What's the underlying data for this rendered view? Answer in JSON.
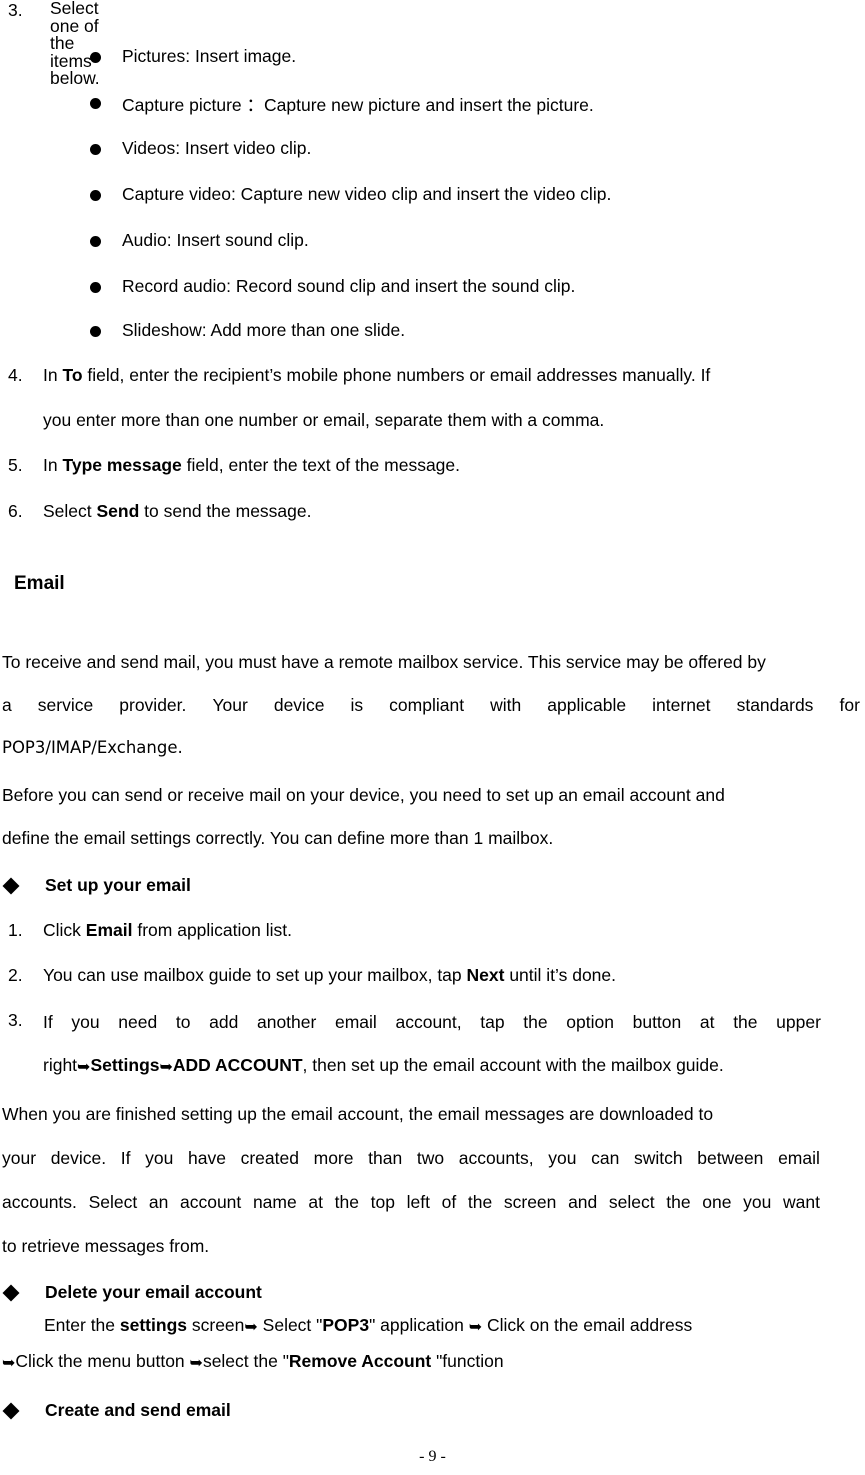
{
  "document": {
    "page_number_label": "- 9 -",
    "arrow_glyph": "➥"
  },
  "list_items_step3": {
    "number": "3.",
    "text": "Select one of the items below.",
    "bullets": [
      "Pictures: Insert image.",
      "Capture picture ：Capture new picture and insert the picture.",
      "Videos: Insert video clip.",
      "Capture video: Capture new video clip and insert the video clip.",
      "Audio: Insert sound clip.",
      "Record audio: Record sound clip and insert the sound clip.",
      "Slideshow: Add more than one slide."
    ]
  },
  "steps": {
    "step4": {
      "number": "4.",
      "line1_a": "In ",
      "line1_b": "To",
      "line1_c": " field, enter the recipient’s mobile phone numbers or email addresses manually. If",
      "line2": "you enter more than one number or email, separate them with a comma."
    },
    "step5": {
      "number": "5.",
      "a": "In ",
      "b": "Type message",
      "c": " field, enter the text of the message."
    },
    "step6": {
      "number": "6.",
      "a": "Select ",
      "b": "Send",
      "c": " to send the message."
    }
  },
  "email_section": {
    "title": "Email",
    "intro_para": {
      "line1": "To receive and send mail, you must have a remote mailbox service. This service may be offered by",
      "line2_words": [
        "a",
        "service",
        "provider.",
        "Your",
        "device",
        "is",
        "compliant",
        "with",
        "applicable",
        "internet",
        "standards",
        "for"
      ],
      "line3": "POP3/IMAP/Exchange."
    },
    "before_para": {
      "line1": "Before you can send or receive mail on your device, you need to set up an email account and",
      "line2": "define the email settings correctly. You can define more than 1 mailbox."
    },
    "setup_heading": "Set up your email",
    "setup_steps": {
      "step1": {
        "number": "1.",
        "a": "Click ",
        "b": "Email",
        "c": " from application list."
      },
      "step2": {
        "number": "2.",
        "a": "You can use mailbox guide to set up your mailbox, tap ",
        "b": "Next",
        "c": " until it’s done."
      },
      "step3": {
        "number": "3.",
        "line1_words": [
          "If",
          "you",
          "need",
          "to",
          "add",
          "another",
          "email",
          "account,",
          "tap",
          "the",
          "option",
          "button",
          "at",
          "the",
          "upper"
        ],
        "line2_a": "right",
        "line2_b": "Settings",
        "line2_c": "ADD ACCOUNT",
        "line2_d": ", then set up the email account with the mailbox guide."
      }
    },
    "finished_para": {
      "line1": "When you are finished setting up the email account, the email messages are downloaded to",
      "line2_words": [
        "your",
        "device.",
        "If",
        "you",
        "have",
        "created",
        "more",
        "than",
        "two",
        "accounts,",
        "you",
        "can",
        "switch",
        "between",
        "email"
      ],
      "line3_words": [
        "accounts.",
        "Select",
        "an",
        "account",
        "name",
        "at",
        "the",
        "top",
        "left",
        "of",
        "the",
        "screen",
        "and",
        "select",
        "the",
        "one",
        "you",
        "want"
      ],
      "line4": "to retrieve messages from."
    },
    "delete_heading": "Delete your email account",
    "delete_body": {
      "line1_a": "Enter the ",
      "line1_b": "settings",
      "line1_c": " screen",
      "line1_d": " Select \"",
      "line1_e": "POP3",
      "line1_f": "\" application ",
      "line1_g": " Click on the email address",
      "line2_a": "Click the menu button ",
      "line2_b": "select the \"",
      "line2_c": "Remove Account",
      "line2_d": " \"function"
    },
    "create_heading": "Create and send email"
  }
}
